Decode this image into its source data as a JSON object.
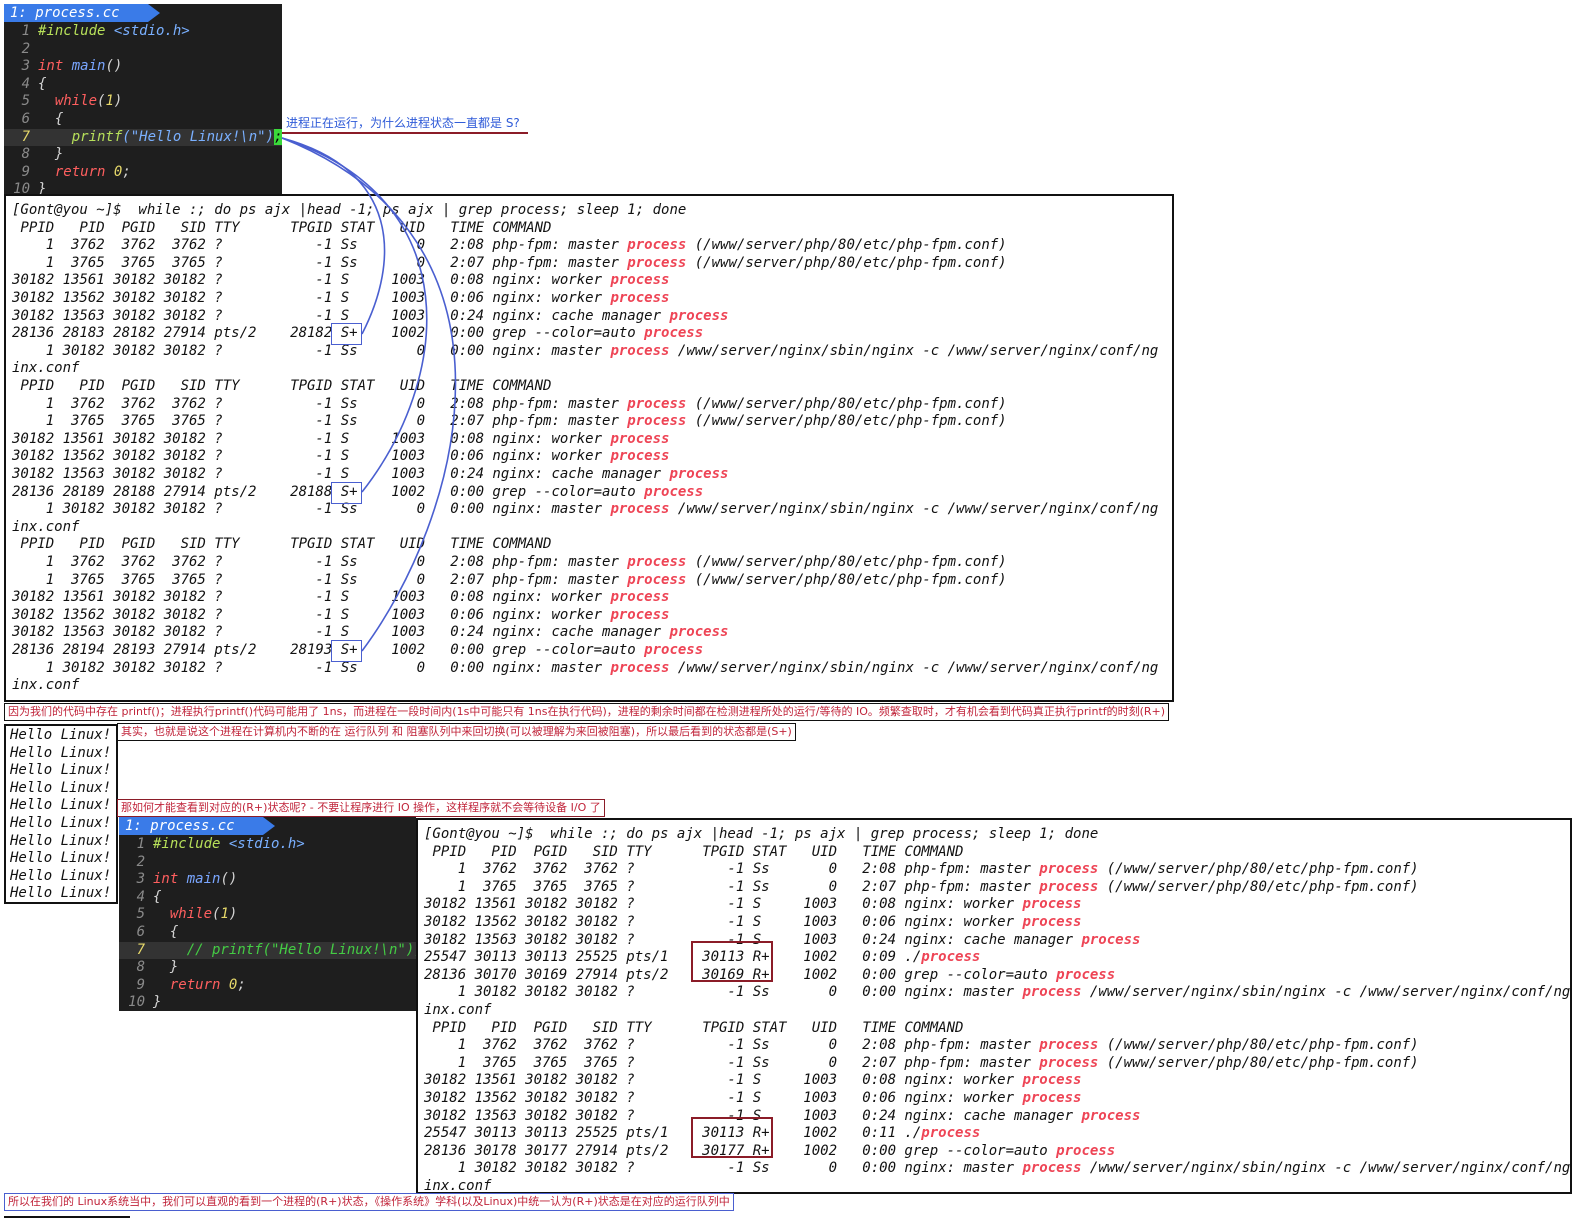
{
  "editor1": {
    "tab_label": "1: process.cc",
    "lines": [
      {
        "n": "1",
        "segs": [
          [
            "#include <stdio.h>",
            "mixinc"
          ]
        ]
      },
      {
        "n": "2",
        "segs": []
      },
      {
        "n": "3",
        "segs": [
          [
            "int ",
            "red"
          ],
          [
            "main",
            "blue"
          ],
          [
            "()",
            "plain"
          ]
        ]
      },
      {
        "n": "4",
        "segs": [
          [
            "{",
            "plain"
          ]
        ]
      },
      {
        "n": "5",
        "segs": [
          [
            "  ",
            "plain"
          ],
          [
            "while",
            "red"
          ],
          [
            "(",
            "plain"
          ],
          [
            "1",
            "yellow"
          ],
          [
            ")",
            "plain"
          ]
        ]
      },
      {
        "n": "6",
        "segs": [
          [
            "  {",
            "plain"
          ]
        ]
      },
      {
        "n": "7",
        "segs": [
          [
            "    ",
            "plain"
          ],
          [
            "printf",
            "green"
          ],
          [
            "(\"Hello Linux!\\n\")",
            "str"
          ],
          [
            ";",
            "cursor"
          ]
        ],
        "current": true
      },
      {
        "n": "8",
        "segs": [
          [
            "  }",
            "plain"
          ]
        ]
      },
      {
        "n": "9",
        "segs": [
          [
            "  ",
            "plain"
          ],
          [
            "return ",
            "red"
          ],
          [
            "0",
            "yellow"
          ],
          [
            ";",
            "plain"
          ]
        ]
      },
      {
        "n": "10",
        "segs": [
          [
            "}",
            "plain"
          ]
        ]
      }
    ]
  },
  "annotation_question": "进程正在运行，为什么进程状态一直都是 S?",
  "terminal1": {
    "lines": [
      "[Gont@you ~]$  while :; do ps ajx |head -1; ps ajx | grep process; sleep 1; done",
      " PPID   PID  PGID   SID TTY      TPGID STAT   UID   TIME COMMAND",
      "    1  3762  3762  3762 ?           -1 Ss       0   2:08 php-fpm: master {p} (/www/server/php/80/etc/php-fpm.conf)",
      "    1  3765  3765  3765 ?           -1 Ss       0   2:07 php-fpm: master {p} (/www/server/php/80/etc/php-fpm.conf)",
      "30182 13561 30182 30182 ?           -1 S     1003   0:08 nginx: worker {p}",
      "30182 13562 30182 30182 ?           -1 S     1003   0:06 nginx: worker {p}",
      "30182 13563 30182 30182 ?           -1 S     1003   0:24 nginx: cache manager {p}",
      "28136 28183 28182 27914 pts/2    28182 S+    1002   0:00 grep --color=auto {p}",
      "    1 30182 30182 30182 ?           -1 Ss       0   0:00 nginx: master {p} /www/server/nginx/sbin/nginx -c /www/server/nginx/conf/ng",
      "inx.conf",
      " PPID   PID  PGID   SID TTY      TPGID STAT   UID   TIME COMMAND",
      "    1  3762  3762  3762 ?           -1 Ss       0   2:08 php-fpm: master {p} (/www/server/php/80/etc/php-fpm.conf)",
      "    1  3765  3765  3765 ?           -1 Ss       0   2:07 php-fpm: master {p} (/www/server/php/80/etc/php-fpm.conf)",
      "30182 13561 30182 30182 ?           -1 S     1003   0:08 nginx: worker {p}",
      "30182 13562 30182 30182 ?           -1 S     1003   0:06 nginx: worker {p}",
      "30182 13563 30182 30182 ?           -1 S     1003   0:24 nginx: cache manager {p}",
      "28136 28189 28188 27914 pts/2    28188 S+    1002   0:00 grep --color=auto {p}",
      "    1 30182 30182 30182 ?           -1 Ss       0   0:00 nginx: master {p} /www/server/nginx/sbin/nginx -c /www/server/nginx/conf/ng",
      "inx.conf",
      " PPID   PID  PGID   SID TTY      TPGID STAT   UID   TIME COMMAND",
      "    1  3762  3762  3762 ?           -1 Ss       0   2:08 php-fpm: master {p} (/www/server/php/80/etc/php-fpm.conf)",
      "    1  3765  3765  3765 ?           -1 Ss       0   2:07 php-fpm: master {p} (/www/server/php/80/etc/php-fpm.conf)",
      "30182 13561 30182 30182 ?           -1 S     1003   0:08 nginx: worker {p}",
      "30182 13562 30182 30182 ?           -1 S     1003   0:06 nginx: worker {p}",
      "30182 13563 30182 30182 ?           -1 S     1003   0:24 nginx: cache manager {p}",
      "28136 28194 28193 27914 pts/2    28193 S+    1002   0:00 grep --color=auto {p}",
      "    1 30182 30182 30182 ?           -1 Ss       0   0:00 nginx: master {p} /www/server/nginx/sbin/nginx -c /www/server/nginx/conf/ng",
      "inx.conf"
    ]
  },
  "note_explain": "因为我们的代码中存在 printf()；进程执行printf()代码可能用了 1ns，而进程在一段时间内(1s中可能只有 1ns在执行代码)，进程的剩余时间都在检测进程所处的运行/等待的 IO。频繁查取时，才有机会看到代码真正执行printf的时刻(R+)",
  "note_queue": "其实，也就是说这个进程在计算机内不断的在 运行队列 和 阻塞队列中来回切换(可以被理解为来回被阻塞)，所以最后看到的状态都是(S+)",
  "hello_output": [
    "Hello Linux!",
    "Hello Linux!",
    "Hello Linux!",
    "Hello Linux!",
    "Hello Linux!",
    "Hello Linux!",
    "Hello Linux!",
    "Hello Linux!",
    "Hello Linux!",
    "Hello Linux!"
  ],
  "note_howto": "那如何才能查看到对应的(R+)状态呢? - 不要让程序进行 IO 操作，这样程序就不会等待设备 I/O 了",
  "editor2": {
    "tab_label": "1: process.cc",
    "lines": [
      {
        "n": "1",
        "segs": [
          [
            "#include <stdio.h>",
            "mixinc"
          ]
        ]
      },
      {
        "n": "2",
        "segs": []
      },
      {
        "n": "3",
        "segs": [
          [
            "int ",
            "red"
          ],
          [
            "main",
            "blue"
          ],
          [
            "()",
            "plain"
          ]
        ]
      },
      {
        "n": "4",
        "segs": [
          [
            "{",
            "plain"
          ]
        ]
      },
      {
        "n": "5",
        "segs": [
          [
            "  ",
            "plain"
          ],
          [
            "while",
            "red"
          ],
          [
            "(",
            "plain"
          ],
          [
            "1",
            "yellow"
          ],
          [
            ")",
            "plain"
          ]
        ]
      },
      {
        "n": "6",
        "segs": [
          [
            "  {",
            "plain"
          ]
        ]
      },
      {
        "n": "7",
        "segs": [
          [
            "    ",
            "plain"
          ],
          [
            "// printf(\"Hello Linux!\\n\");",
            "comment"
          ]
        ],
        "current": true
      },
      {
        "n": "8",
        "segs": [
          [
            "  }",
            "plain"
          ]
        ]
      },
      {
        "n": "9",
        "segs": [
          [
            "  ",
            "plain"
          ],
          [
            "return ",
            "red"
          ],
          [
            "0",
            "yellow"
          ],
          [
            ";",
            "plain"
          ]
        ]
      },
      {
        "n": "10",
        "segs": [
          [
            "}",
            "plain"
          ]
        ]
      }
    ]
  },
  "terminal2": {
    "lines": [
      "[Gont@you ~]$  while :; do ps ajx |head -1; ps ajx | grep process; sleep 1; done",
      " PPID   PID  PGID   SID TTY      TPGID STAT   UID   TIME COMMAND",
      "    1  3762  3762  3762 ?           -1 Ss       0   2:08 php-fpm: master {p} (/www/server/php/80/etc/php-fpm.conf)",
      "    1  3765  3765  3765 ?           -1 Ss       0   2:07 php-fpm: master {p} (/www/server/php/80/etc/php-fpm.conf)",
      "30182 13561 30182 30182 ?           -1 S     1003   0:08 nginx: worker {p}",
      "30182 13562 30182 30182 ?           -1 S     1003   0:06 nginx: worker {p}",
      "30182 13563 30182 30182 ?           -1 S     1003   0:24 nginx: cache manager {p}",
      "25547 30113 30113 25525 pts/1    30113 R+    1002   0:09 ./{p}",
      "28136 30170 30169 27914 pts/2    30169 R+    1002   0:00 grep --color=auto {p}",
      "    1 30182 30182 30182 ?           -1 Ss       0   0:00 nginx: master {p} /www/server/nginx/sbin/nginx -c /www/server/nginx/conf/ng",
      "inx.conf",
      " PPID   PID  PGID   SID TTY      TPGID STAT   UID   TIME COMMAND",
      "    1  3762  3762  3762 ?           -1 Ss       0   2:08 php-fpm: master {p} (/www/server/php/80/etc/php-fpm.conf)",
      "    1  3765  3765  3765 ?           -1 Ss       0   2:07 php-fpm: master {p} (/www/server/php/80/etc/php-fpm.conf)",
      "30182 13561 30182 30182 ?           -1 S     1003   0:08 nginx: worker {p}",
      "30182 13562 30182 30182 ?           -1 S     1003   0:06 nginx: worker {p}",
      "30182 13563 30182 30182 ?           -1 S     1003   0:24 nginx: cache manager {p}",
      "25547 30113 30113 25525 pts/1    30113 R+    1002   0:11 ./{p}",
      "28136 30178 30177 27914 pts/2    30177 R+    1002   0:00 grep --color=auto {p}",
      "    1 30182 30182 30182 ?           -1 Ss       0   0:00 nginx: master {p} /www/server/nginx/sbin/nginx -c /www/server/nginx/conf/ng",
      "inx.conf"
    ]
  },
  "highlight_word": "process",
  "note_conclusion": "所以在我们的 Linux系统当中，我们可以直观的看到一个进程的(R+)状态，《操作系统》学科(以及Linux)中统一认为(R+)状态是在对应的运行队列中",
  "colors": {
    "highlight": "#ee4455",
    "blue_box": "#4a5fd0",
    "red_box": "#8b1c28",
    "vim_bg": "#1e1e1e",
    "tab_bg": "#3a7be8"
  }
}
